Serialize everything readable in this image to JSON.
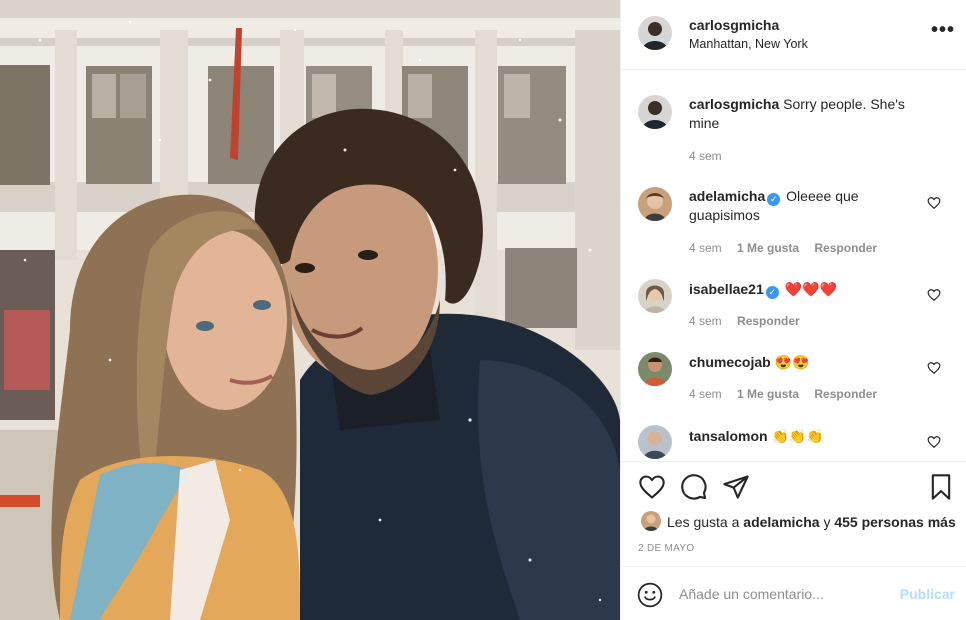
{
  "post": {
    "photo_description_icon": "couple-selfie-photo"
  },
  "header": {
    "username": "carlosgmicha",
    "location": "Manhattan, New York",
    "more_label": "•••"
  },
  "caption": {
    "username": "carlosgmicha",
    "text": "Sorry people. She's mine",
    "time": "4 sem"
  },
  "comments": [
    {
      "username": "adelamicha",
      "verified": true,
      "text": "Oleeee que guapisimos",
      "time": "4 sem",
      "likes": "1 Me gusta",
      "reply": "Responder"
    },
    {
      "username": "isabellae21",
      "verified": true,
      "text": "❤️❤️❤️",
      "time": "4 sem",
      "reply": "Responder"
    },
    {
      "username": "chumecojab",
      "verified": false,
      "text": "😍😍",
      "time": "4 sem",
      "likes": "1 Me gusta",
      "reply": "Responder"
    },
    {
      "username": "tansalomon",
      "verified": false,
      "text": "👏👏👏"
    }
  ],
  "likes": {
    "prefix": "Les gusta a",
    "user": "adelamicha",
    "connector": "y",
    "others": "455 personas más"
  },
  "date": "2 DE MAYO",
  "comment_box": {
    "placeholder": "Añade un comentario...",
    "publish_label": "Publicar"
  },
  "colors": {
    "verified": "#3897f0",
    "publish_disabled": "#b2dffc",
    "heart_red": "#c40000"
  }
}
